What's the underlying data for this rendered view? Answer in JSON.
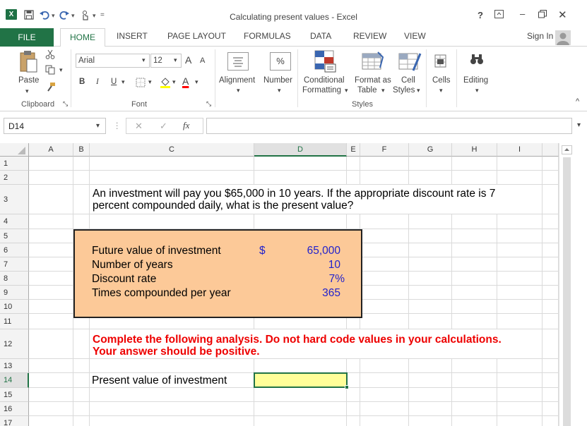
{
  "window": {
    "title": "Calculating present values - Excel",
    "logo": "X",
    "help": "?",
    "sign_in": "Sign In"
  },
  "tabs": [
    "FILE",
    "HOME",
    "INSERT",
    "PAGE LAYOUT",
    "FORMULAS",
    "DATA",
    "REVIEW",
    "VIEW"
  ],
  "ribbon": {
    "paste": "Paste",
    "clipboard": "Clipboard",
    "font_name": "Arial",
    "font_size": "12",
    "font_group": "Font",
    "bold": "B",
    "italic": "I",
    "underline": "U",
    "font_color_letter": "A",
    "grow_a": "A",
    "shrink_a": "A",
    "alignment": "Alignment",
    "number": "Number",
    "number_symbol": "%",
    "conditional_1": "Conditional",
    "conditional_2": "Formatting",
    "format_table_1": "Format as",
    "format_table_2": "Table",
    "cell_styles_1": "Cell",
    "cell_styles_2": "Styles",
    "styles_group": "Styles",
    "cells": "Cells",
    "editing": "Editing"
  },
  "formula_bar": {
    "name_box": "D14",
    "fx": "fx",
    "formula": ""
  },
  "columns": [
    "A",
    "B",
    "C",
    "D",
    "E",
    "F",
    "G",
    "H",
    "I"
  ],
  "rows": [
    "1",
    "2",
    "3",
    "4",
    "5",
    "6",
    "7",
    "8",
    "9",
    "10",
    "11",
    "12",
    "13",
    "14",
    "15",
    "16",
    "17"
  ],
  "sheet": {
    "question_line1": "An investment will pay you $65,000 in 10 years. If the appropriate discount rate is 7",
    "question_line2": "percent compounded daily, what is the present value?",
    "inputs": [
      {
        "label": "Future value of investment",
        "currency": "$",
        "value": "65,000"
      },
      {
        "label": "Number of years",
        "value": "10"
      },
      {
        "label": "Discount rate",
        "value": "7%"
      },
      {
        "label": "Times compounded per year",
        "value": "365"
      }
    ],
    "instruction_line1": "Complete the following analysis. Do not hard code values in your calculations.",
    "instruction_line2": "Your answer should be positive.",
    "result_label": "Present value of investment",
    "result_value": ""
  },
  "colors": {
    "excel_green": "#217346",
    "input_box": "#fcc998",
    "answer_cell": "#ffff99",
    "instruction": "#ee0000",
    "value_blue": "#2222cc"
  }
}
